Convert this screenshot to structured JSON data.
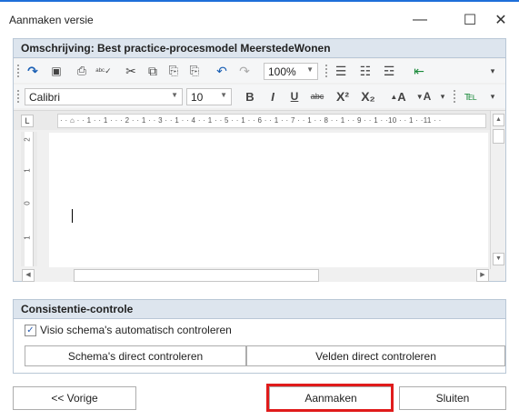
{
  "window": {
    "title": "Aanmaken versie",
    "minimize_glyph": "—",
    "maximize_glyph": "☐",
    "close_glyph": "✕"
  },
  "description": {
    "header": "Omschrijving: Best practice-procesmodel MeerstedeWonen"
  },
  "toolbar": {
    "row1": {
      "redo_icon": "↷",
      "save_icon": "💾",
      "print_icon": "🖶",
      "spellcheck_icon": "ᵃᵇᶜ✓",
      "cut_icon": "✂",
      "copy_icon": "⧉",
      "paste_icon": "📋",
      "paste_special_icon": "📋",
      "undo_icon": "↶",
      "redo2_icon": "↷",
      "zoom_value": "100%",
      "bullets_icon": "☰",
      "numbering_icon": "☷",
      "multilevel_icon": "☲",
      "indent_icon": "⇤",
      "more_icon": "▾"
    },
    "row2": {
      "font_name": "Calibri",
      "font_size": "10",
      "bold": "B",
      "italic": "I",
      "underline": "U",
      "strike": "abc",
      "superscript": "X²",
      "subscript": "X₂",
      "grow_font": "A",
      "shrink_font": "A",
      "style_icon": "℡",
      "more_icon": "▾"
    }
  },
  "ruler": {
    "corner": "L",
    "scale": "· · ⌂ · · 1 · · 1 · · · 2 · · 1 · · 3 · · 1 · · 4 · · 1 · · 5 · · 1 · · 6 · · 1 · · 7 · · 1 · · 8 · · 1 · · 9 · · 1 · ·10 · · 1 · ·11 · ·",
    "vertical": [
      "2",
      "1",
      "0",
      "1"
    ]
  },
  "scrollbar": {
    "up": "▲",
    "down": "▼",
    "left": "◀",
    "right": "▶"
  },
  "consistency": {
    "header": "Consistentie-controle",
    "checkbox_label": "Visio schema's automatisch controleren",
    "checkbox_checked": true,
    "check_mark": "✓",
    "schema_button": "Schema's direct controleren",
    "fields_button": "Velden direct controleren"
  },
  "footer": {
    "previous": "<< Vorige",
    "create": "Aanmaken",
    "close": "Sluiten"
  },
  "colors": {
    "accent": "#1e6fd9",
    "highlight": "#e01b1b",
    "panel_header": "#dde5ee"
  }
}
